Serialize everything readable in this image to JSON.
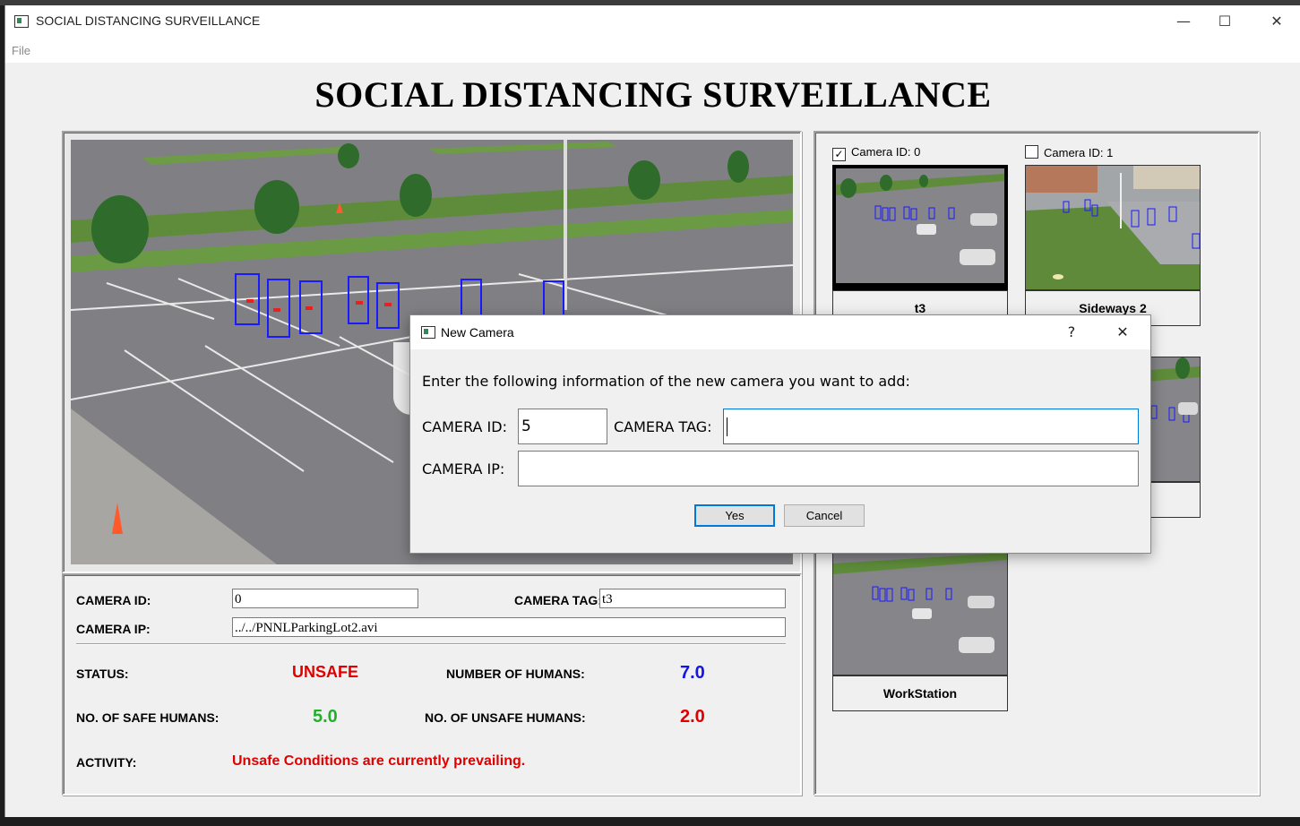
{
  "window": {
    "title": "SOCIAL DISTANCING SURVEILLANCE",
    "minimize_glyph": "—",
    "maximize_glyph": "☐",
    "close_glyph": "✕"
  },
  "menu": {
    "file_label": "File"
  },
  "heading": "SOCIAL DISTANCING SURVEILLANCE",
  "info_panel": {
    "camera_id_label": "CAMERA ID:",
    "camera_id_value": "0",
    "camera_tag_label": "CAMERA TAG:",
    "camera_tag_value": "t3",
    "camera_ip_label": "CAMERA IP:",
    "camera_ip_value": "../../PNNLParkingLot2.avi",
    "status_label": "STATUS:",
    "status_value": "UNSAFE",
    "num_humans_label": "NUMBER OF HUMANS:",
    "num_humans_value": "7.0",
    "safe_humans_label": "NO. OF SAFE HUMANS:",
    "safe_humans_value": "5.0",
    "unsafe_humans_label": "NO. OF UNSAFE HUMANS:",
    "unsafe_humans_value": "2.0",
    "activity_label": "ACTIVITY:",
    "activity_value": "Unsafe Conditions are currently prevailing."
  },
  "cameras": [
    {
      "checkbox_label": "Camera ID: 0",
      "checked": true,
      "tag": "t3"
    },
    {
      "checkbox_label": "Camera ID: 1",
      "checked": false,
      "tag": "Sideways 2"
    },
    {
      "checkbox_label": "",
      "checked": false,
      "tag": ""
    },
    {
      "checkbox_label": "",
      "checked": false,
      "tag": "WorkStation"
    }
  ],
  "dialog": {
    "title": "New Camera",
    "help_glyph": "?",
    "close_glyph": "✕",
    "prompt": "Enter the following information of the new camera you want to add:",
    "camera_id_label": "CAMERA ID:",
    "camera_id_value": "5",
    "camera_tag_label": "CAMERA TAG:",
    "camera_tag_value": "",
    "camera_ip_label": "CAMERA IP:",
    "camera_ip_value": "",
    "yes_label": "Yes",
    "cancel_label": "Cancel"
  },
  "colors": {
    "unsafe_red": "#e00000",
    "safe_green": "#22b02a",
    "count_blue": "#1414e6",
    "detection_box": "#1a1aff",
    "focus_blue": "#0078d7"
  }
}
